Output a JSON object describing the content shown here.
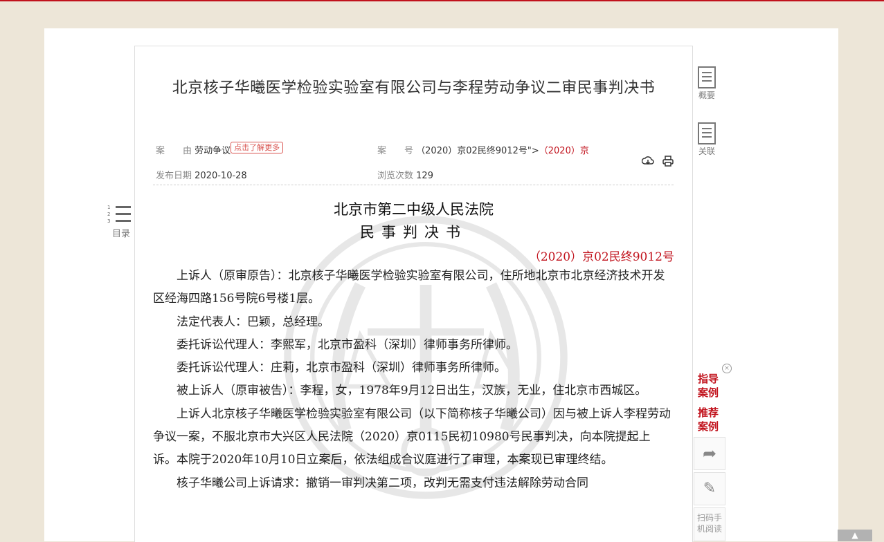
{
  "document": {
    "title": "北京核子华曦医学检验实验室有限公司与李程劳动争议二审民事判决书",
    "meta": {
      "cause_label": "案　　由",
      "cause_value": "劳动争议",
      "cause_tag": "点击了解更多",
      "case_label": "案　　号",
      "case_value": "（2020）京02民终9012号\">",
      "case_value_red": "（2020）京",
      "date_label": "发布日期",
      "date_value": "2020-10-28",
      "views_label": "浏览次数",
      "views_value": "129"
    },
    "court": "北京市第二中级人民法院",
    "doc_type": "民事判决书",
    "case_number": "（2020）京02民终9012号",
    "paragraphs": [
      "上诉人（原审原告）：北京核子华曦医学检验实验室有限公司，住所地北京市北京经济技术开发区经海四路156号院6号楼1层。",
      "法定代表人：巴颖，总经理。",
      "委托诉讼代理人：李熙军，北京市盈科（深圳）律师事务所律师。",
      "委托诉讼代理人：庄莉，北京市盈科（深圳）律师事务所律师。",
      "被上诉人（原审被告）：李程，女，1978年9月12日出生，汉族，无业，住北京市西城区。",
      "上诉人北京核子华曦医学检验实验室有限公司（以下简称核子华曦公司）因与被上诉人李程劳动争议一案，不服北京市大兴区人民法院（2020）京0115民初10980号民事判决，向本院提起上诉。本院于2020年10月10日立案后，依法组成合议庭进行了审理，本案现已审理终结。",
      "核子华曦公司上诉请求：撤销一审判决第二项，改判无需支付违法解除劳动合同"
    ]
  },
  "left_nav": {
    "toc_label": "目录",
    "toc_numbers": [
      "1",
      "2",
      "3"
    ]
  },
  "right_nav": {
    "summary_label": "概要",
    "related_label": "关联",
    "guide_case": "指导案例",
    "recommend_case": "推荐案例",
    "scan_label": "扫码手机阅读",
    "close_glyph": "×",
    "share_glyph": "➦",
    "edit_glyph": "✎",
    "top_glyph": "▲"
  },
  "colors": {
    "accent": "#c1121c",
    "background": "#ede6d8"
  }
}
